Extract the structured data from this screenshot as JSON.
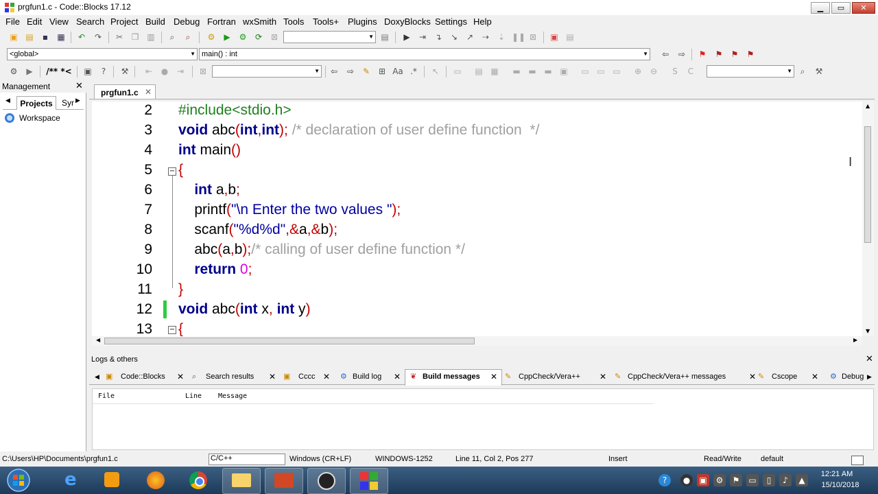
{
  "window": {
    "title": "prgfun1.c - Code::Blocks 17.12"
  },
  "menu": [
    "File",
    "Edit",
    "View",
    "Search",
    "Project",
    "Build",
    "Debug",
    "Fortran",
    "wxSmith",
    "Tools",
    "Tools+",
    "Plugins",
    "DoxyBlocks",
    "Settings",
    "Help"
  ],
  "scope": {
    "left": "<global>",
    "right": "main() : int"
  },
  "toolbar3": {
    "comment_label": "/** *<"
  },
  "management": {
    "title": "Management",
    "tabs": [
      "Projects",
      "Syr"
    ],
    "tree_item": "Workspace"
  },
  "editor": {
    "file_tab": "prgfun1.c",
    "lines": [
      {
        "num": "2",
        "segs": [
          {
            "t": "#include<stdio.h>",
            "c": "pp"
          }
        ]
      },
      {
        "num": "3",
        "segs": [
          {
            "t": "void",
            "c": "kw"
          },
          {
            "t": " abc",
            "c": ""
          },
          {
            "t": "(",
            "c": "op"
          },
          {
            "t": "int",
            "c": "kw"
          },
          {
            "t": ",",
            "c": "op"
          },
          {
            "t": "int",
            "c": "kw"
          },
          {
            "t": ");",
            "c": "op"
          },
          {
            "t": " /* declaration of user define function  */",
            "c": "cm"
          }
        ]
      },
      {
        "num": "4",
        "segs": [
          {
            "t": "int",
            "c": "kw"
          },
          {
            "t": " main",
            "c": ""
          },
          {
            "t": "()",
            "c": "op"
          }
        ]
      },
      {
        "num": "5",
        "segs": [
          {
            "t": "{",
            "c": "op"
          }
        ]
      },
      {
        "num": "6",
        "segs": [
          {
            "t": "    ",
            "c": ""
          },
          {
            "t": "int",
            "c": "kw"
          },
          {
            "t": " a",
            "c": ""
          },
          {
            "t": ",",
            "c": "op"
          },
          {
            "t": "b",
            "c": ""
          },
          {
            "t": ";",
            "c": "op"
          }
        ]
      },
      {
        "num": "7",
        "segs": [
          {
            "t": "    printf",
            "c": ""
          },
          {
            "t": "(",
            "c": "op"
          },
          {
            "t": "\"\\n Enter the two values \"",
            "c": "st"
          },
          {
            "t": ");",
            "c": "op"
          }
        ]
      },
      {
        "num": "8",
        "segs": [
          {
            "t": "    scanf",
            "c": ""
          },
          {
            "t": "(",
            "c": "op"
          },
          {
            "t": "\"%d%d\"",
            "c": "st"
          },
          {
            "t": ",&",
            "c": "op"
          },
          {
            "t": "a",
            "c": ""
          },
          {
            "t": ",&",
            "c": "op"
          },
          {
            "t": "b",
            "c": ""
          },
          {
            "t": ");",
            "c": "op"
          }
        ]
      },
      {
        "num": "9",
        "segs": [
          {
            "t": "    abc",
            "c": ""
          },
          {
            "t": "(",
            "c": "op"
          },
          {
            "t": "a",
            "c": ""
          },
          {
            "t": ",",
            "c": "op"
          },
          {
            "t": "b",
            "c": ""
          },
          {
            "t": ");",
            "c": "op"
          },
          {
            "t": "/* calling of user define function */",
            "c": "cm"
          }
        ]
      },
      {
        "num": "10",
        "segs": [
          {
            "t": "    ",
            "c": ""
          },
          {
            "t": "return",
            "c": "kw"
          },
          {
            "t": " ",
            "c": ""
          },
          {
            "t": "0",
            "c": "nm"
          },
          {
            "t": ";",
            "c": "op"
          }
        ]
      },
      {
        "num": "11",
        "segs": [
          {
            "t": "}",
            "c": "op"
          }
        ]
      },
      {
        "num": "12",
        "segs": [
          {
            "t": "void",
            "c": "kw"
          },
          {
            "t": " abc",
            "c": ""
          },
          {
            "t": "(",
            "c": "op"
          },
          {
            "t": "int",
            "c": "kw"
          },
          {
            "t": " x",
            "c": ""
          },
          {
            "t": ",",
            "c": "op"
          },
          {
            "t": " ",
            "c": ""
          },
          {
            "t": "int",
            "c": "kw"
          },
          {
            "t": " y",
            "c": ""
          },
          {
            "t": ")",
            "c": "op"
          }
        ]
      },
      {
        "num": "13",
        "segs": [
          {
            "t": "{",
            "c": "op"
          }
        ]
      }
    ]
  },
  "logs": {
    "title": "Logs & others",
    "tabs": [
      "Code::Blocks",
      "Search results",
      "Cccc",
      "Build log",
      "Build messages",
      "CppCheck/Vera++",
      "CppCheck/Vera++ messages",
      "Cscope",
      "Debug"
    ],
    "active_tab": "Build messages",
    "columns": [
      "File",
      "Line",
      "Message"
    ]
  },
  "status": {
    "path": "C:\\Users\\HP\\Documents\\prgfun1.c",
    "language": "C/C++",
    "eol": "Windows (CR+LF)",
    "encoding": "WINDOWS-1252",
    "position": "Line 11, Col 2, Pos 277",
    "mode": "Insert",
    "access": "Read/Write",
    "profile": "default"
  },
  "taskbar": {
    "time": "12:21 AM",
    "date": "15/10/2018"
  },
  "colors": {
    "keyword": "#00008b",
    "preprocessor": "#208020",
    "comment": "#a0a0a0",
    "string": "#0000a0",
    "operator": "#c00000",
    "number": "#e000e0"
  }
}
